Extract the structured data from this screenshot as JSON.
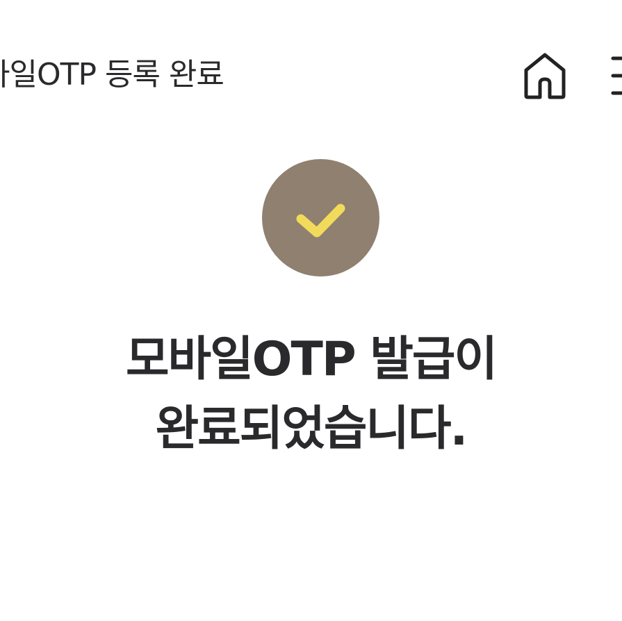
{
  "header": {
    "title": "바일OTP  등록 완료",
    "home_icon": "home-icon",
    "menu_icon": "menu-icon"
  },
  "status": {
    "icon": "check-icon",
    "badge_color": "#8f8070",
    "check_color": "#f2db5a"
  },
  "message": {
    "line1": "모바일OTP 발급이",
    "line2": "완료되었습니다."
  }
}
